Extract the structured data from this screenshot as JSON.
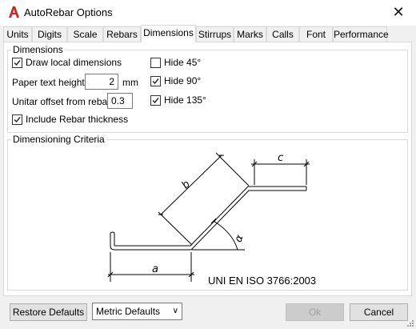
{
  "window": {
    "title": "AutoRebar Options",
    "close": "✕"
  },
  "tabs": [
    {
      "label": "Units"
    },
    {
      "label": "Digits"
    },
    {
      "label": "Scale"
    },
    {
      "label": "Rebars"
    },
    {
      "label": "Dimensions"
    },
    {
      "label": "Stirrups"
    },
    {
      "label": "Marks"
    },
    {
      "label": "Calls"
    },
    {
      "label": "Font"
    },
    {
      "label": "Performance"
    }
  ],
  "active_tab": "Dimensions",
  "dimensions": {
    "group_label": "Dimensions",
    "draw_local": {
      "label": "Draw local dimensions",
      "checked": true
    },
    "paper_text_height": {
      "label": "Paper text height:",
      "value": "2",
      "unit": "mm"
    },
    "unitar_offset": {
      "label": "Unitar offset from rebar:",
      "value": "0.3"
    },
    "include_thickness": {
      "label": "Include Rebar thickness",
      "checked": true
    },
    "hide45": {
      "label": "Hide 45°",
      "checked": false
    },
    "hide90": {
      "label": "Hide 90°",
      "checked": true
    },
    "hide135": {
      "label": "Hide 135°",
      "checked": true
    }
  },
  "criteria": {
    "group_label": "Dimensioning Criteria",
    "labels": {
      "a": "a",
      "b": "b",
      "c": "c",
      "alpha": "α"
    },
    "standard": "UNI EN ISO 3766:2003"
  },
  "footer": {
    "restore": "Restore Defaults",
    "preset": "Metric Defaults",
    "ok": "Ok",
    "cancel": "Cancel"
  },
  "colors": {
    "app_icon": "#c62828"
  }
}
